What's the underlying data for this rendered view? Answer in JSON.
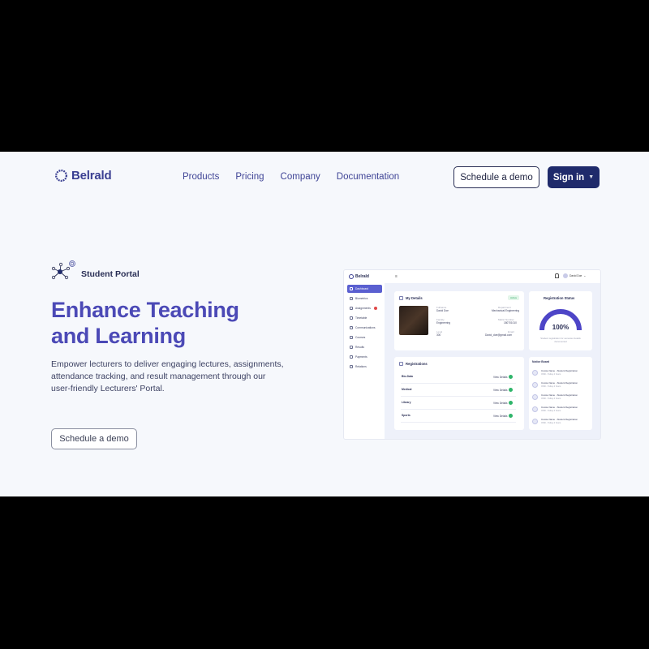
{
  "brand": {
    "name": "Belrald",
    "accent": "#4b49b6",
    "navy": "#1f2a6b"
  },
  "nav": [
    {
      "label": "Products"
    },
    {
      "label": "Pricing"
    },
    {
      "label": "Company"
    },
    {
      "label": "Documentation"
    }
  ],
  "header": {
    "demo_label": "Schedule a demo",
    "signin_label": "Sign in",
    "signin_icon": "chevron-down-icon"
  },
  "hero": {
    "eyebrow_icon": "network-nodes-icon",
    "eyebrow": "Student Portal",
    "title_line1": "Enhance Teaching",
    "title_line2": "and Learning",
    "description": "Empower lecturers to deliver engaging lectures, assignments, attendance tracking, and result management through our user-friendly Lecturers' Portal.",
    "cta_label": "Schedule a demo"
  },
  "dashboard": {
    "logo": "Belrald",
    "user": "David Doe",
    "menu": [
      {
        "label": "Dashboard",
        "active": true
      },
      {
        "label": "Biometrics"
      },
      {
        "label": "Assignments",
        "badge": true
      },
      {
        "label": "Timetable"
      },
      {
        "label": "Communications"
      },
      {
        "label": "Courses"
      },
      {
        "label": "Results"
      },
      {
        "label": "Payments"
      },
      {
        "label": "Relations"
      }
    ],
    "my_details": {
      "title": "My Details",
      "status": "Active",
      "name": "David Doe",
      "faculty": "Engineering",
      "level": "300",
      "department": "Mechanical Engineering",
      "matric": "180701010",
      "email": "David_doe@gmail.com"
    },
    "registration_status": {
      "title": "Registration Status",
      "value": "100%",
      "fraction": 1.0,
      "note": "Student registration for semester details documented"
    },
    "registrations": {
      "title": "Registrations",
      "link_label": "View Details",
      "rows": [
        "Bio-Data",
        "Medical",
        "Library",
        "Sports"
      ]
    },
    "notice_board": {
      "title": "Notice Board",
      "items": [
        {
          "text": "Invoice Name - Student Registration",
          "sub": "OND - Today 2 hours"
        },
        {
          "text": "Invoice Name - Student Registration",
          "sub": "OND - Today 2 hours"
        },
        {
          "text": "Invoice Name - Student Registration",
          "sub": "OND - Today 2 hours"
        },
        {
          "text": "Invoice Name - Student Registration",
          "sub": "OND - Today 2 hours"
        },
        {
          "text": "Invoice Name - Student Registration",
          "sub": "OND - Today 2 hours"
        }
      ]
    }
  }
}
